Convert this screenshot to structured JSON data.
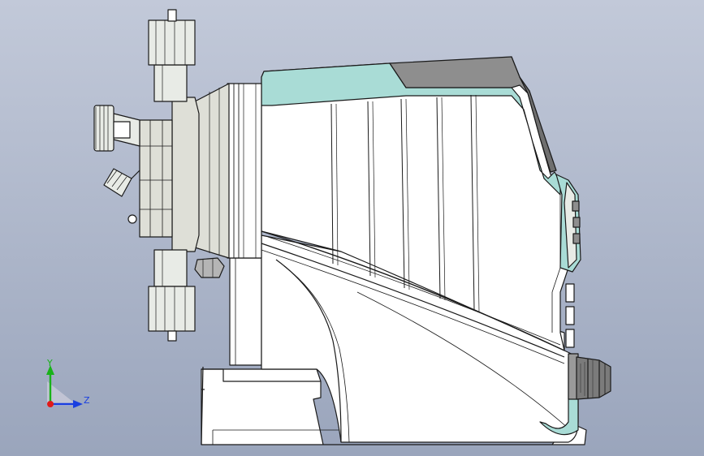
{
  "viewport": {
    "background_top": "#c2c9d9",
    "background_bottom": "#9aa5bc"
  },
  "model": {
    "body_fill": "#ffffff",
    "accent_teal": "#a9dcd6",
    "accent_teal_dark": "#7fc0b8",
    "housing_grey": "#dedfd7",
    "valve_fill": "#e8ebe6",
    "dark_grey": "#8e8e8e",
    "outline": "#1a1a1a"
  },
  "triad": {
    "y_label": "Y",
    "z_label": "Z",
    "y_color": "#19b219",
    "z_color": "#1a3fe0",
    "x_color": "#e01a1a"
  }
}
